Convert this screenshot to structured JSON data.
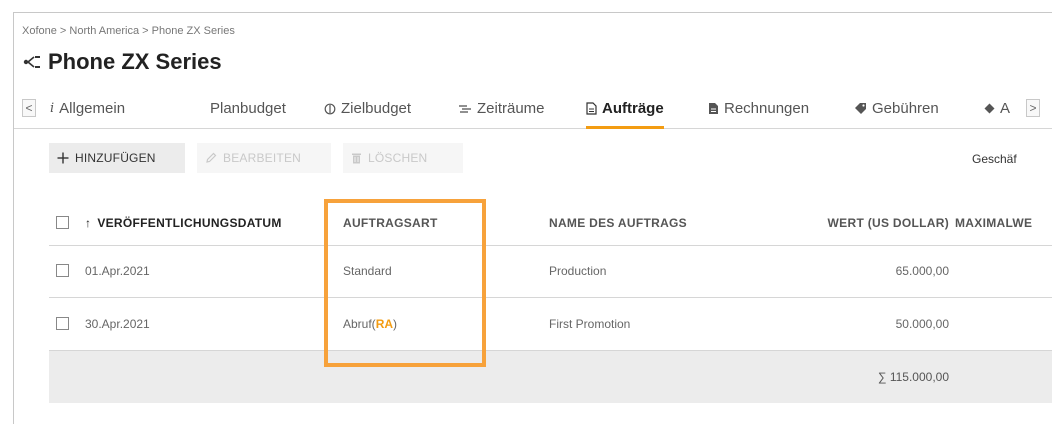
{
  "breadcrumb": [
    "Xofone",
    "North America",
    "Phone ZX Series"
  ],
  "breadcrumb_sep": " > ",
  "page": {
    "title": "Phone ZX Series",
    "icon": "hierarchy-icon"
  },
  "tabs": [
    {
      "label": "Allgemein",
      "icon": "info-icon",
      "active": false
    },
    {
      "label": "Planbudget",
      "icon": "",
      "active": false
    },
    {
      "label": "Zielbudget",
      "icon": "target-icon",
      "active": false
    },
    {
      "label": "Zeiträume",
      "icon": "timeline-icon",
      "active": false
    },
    {
      "label": "Aufträge",
      "icon": "document-icon",
      "active": true
    },
    {
      "label": "Rechnungen",
      "icon": "invoice-icon",
      "active": false
    },
    {
      "label": "Gebühren",
      "icon": "tag-icon",
      "active": false
    },
    {
      "label": "A",
      "icon": "diamond-icon",
      "active": false
    }
  ],
  "tab_nav": {
    "left": "<",
    "right": ">"
  },
  "toolbar": {
    "add_label": "HINZUFÜGEN",
    "edit_label": "BEARBEITEN",
    "delete_label": "LÖSCHEN",
    "right_hint": "Geschäf"
  },
  "table": {
    "columns": [
      "VERÖFFENTLICHUNGSDATUM",
      "AUFTRAGSART",
      "NAME DES AUFTRAGS",
      "WERT (US DOLLAR)",
      "MAXIMALWE"
    ],
    "sort_column": "VERÖFFENTLICHUNGSDATUM",
    "rows": [
      {
        "date": "01.Apr.2021",
        "type": "Standard",
        "type_suffix": "",
        "name": "Production",
        "value": "65.000,00"
      },
      {
        "date": "30.Apr.2021",
        "type": "Abruf(",
        "type_suffix": "RA",
        "type_close": ")",
        "name": "First Promotion",
        "value": "50.000,00"
      }
    ],
    "sum_symbol": "∑",
    "sum_value": "115.000,00"
  },
  "colors": {
    "accent": "#f39c12",
    "highlight": "#f7a23b",
    "sum_row": "#ececec"
  }
}
